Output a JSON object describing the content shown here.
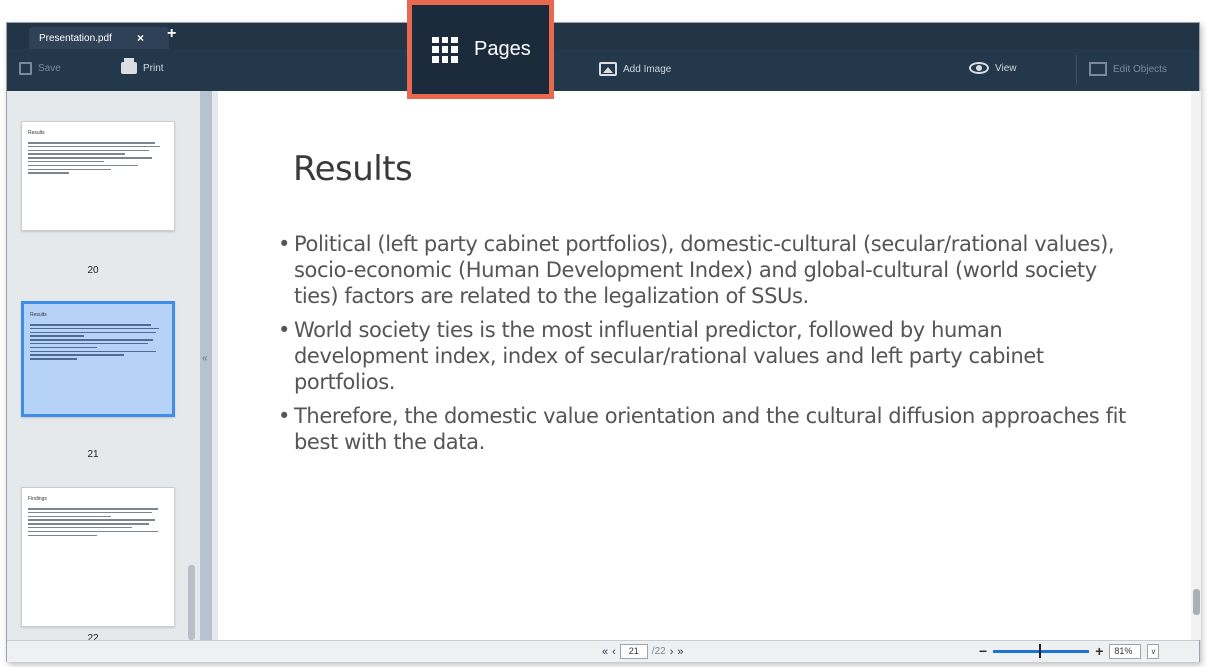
{
  "tab": {
    "title": "Presentation.pdf",
    "close": "×",
    "add": "+"
  },
  "toolbar": {
    "save": "Save",
    "print": "Print",
    "pages": "Pages",
    "add_image": "Add Image",
    "view": "View",
    "edit_objects": "Edit Objects"
  },
  "thumbnails": [
    {
      "title": "Results",
      "page": "20",
      "lines": 9,
      "selected": false
    },
    {
      "title": "Results",
      "page": "21",
      "lines": 12,
      "selected": true
    },
    {
      "title": "Findings",
      "page": "22",
      "lines": 11,
      "selected": false
    }
  ],
  "document": {
    "title": "Results",
    "bullets": [
      "Political (left party cabinet portfolios), domestic-cultural (secular/rational values), socio-economic (Human Development Index) and global-cultural (world society ties) factors are related to the legalization of SSUs.",
      "World society ties is the most influential predictor, followed by human development index, index of secular/rational values and left party cabinet portfolios.",
      "Therefore, the domestic value orientation and the cultural diffusion approaches fit best with the data."
    ]
  },
  "status": {
    "first": "«",
    "prev": "‹",
    "current_page": "21",
    "total_pages": "/22",
    "next": "›",
    "last": "»",
    "zoom_minus": "−",
    "zoom_plus": "+",
    "zoom_value": "81%",
    "zoom_level": 0.48,
    "dropdown": "∨"
  },
  "colors": {
    "accent": "#3d8ee8",
    "highlight": "#e8694f",
    "toolbar": "#24384c"
  }
}
